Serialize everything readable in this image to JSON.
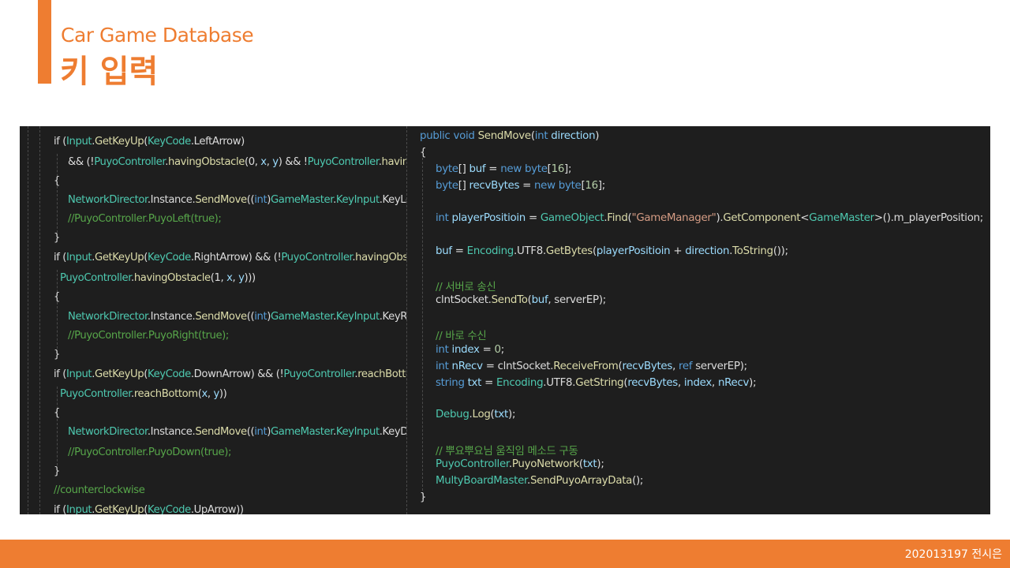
{
  "slide": {
    "title": "Car Game Database",
    "subtitle": "키 입력",
    "footer_text": "202013197 전시은"
  },
  "colors": {
    "accent": "#ee7d31",
    "editor_background": "#1e1e1e",
    "keyword": "#569cd6",
    "type": "#4ec9b0",
    "method": "#dcdcaa",
    "comment": "#57a64a",
    "string": "#d69d85",
    "number": "#b5cea8",
    "variable": "#9cdcfe",
    "plain": "#dcdcdc"
  },
  "left_code_lines": [
    [
      [
        "plain",
        "if ("
      ],
      [
        "type",
        "Input"
      ],
      [
        "plain",
        "."
      ],
      [
        "method",
        "GetKeyUp"
      ],
      [
        "plain",
        "("
      ],
      [
        "type",
        "KeyCode"
      ],
      [
        "plain",
        "."
      ],
      [
        "plain",
        "LeftArrow"
      ],
      [
        "plain",
        ")"
      ]
    ],
    [
      [
        "plain",
        "&& (!"
      ],
      [
        "type",
        "PuyoController"
      ],
      [
        "plain",
        "."
      ],
      [
        "method",
        "havingObstacle"
      ],
      [
        "plain",
        "(0, "
      ],
      [
        "variable",
        "x"
      ],
      [
        "plain",
        ", "
      ],
      [
        "variable",
        "y"
      ],
      [
        "plain",
        ") && !"
      ],
      [
        "type",
        "PuyoController"
      ],
      [
        "plain",
        "."
      ],
      [
        "method",
        "havingObstacle"
      ],
      [
        "plain",
        "(1, x, y)))"
      ]
    ],
    [
      [
        "plain",
        "{"
      ]
    ],
    [
      [
        "type",
        "NetworkDirector"
      ],
      [
        "plain",
        "."
      ],
      [
        "plain",
        "Instance"
      ],
      [
        "plain",
        "."
      ],
      [
        "method",
        "SendMove"
      ],
      [
        "plain",
        "(("
      ],
      [
        "keyword",
        "int"
      ],
      [
        "plain",
        ")"
      ],
      [
        "type",
        "GameMaster"
      ],
      [
        "plain",
        "."
      ],
      [
        "type",
        "KeyInput"
      ],
      [
        "plain",
        "."
      ],
      [
        "plain",
        "KeyLeft);"
      ]
    ],
    [
      [
        "comment",
        "//PuyoController.PuyoLeft(true);"
      ]
    ],
    [
      [
        "plain",
        "}"
      ]
    ],
    [
      [
        "plain",
        "if ("
      ],
      [
        "type",
        "Input"
      ],
      [
        "plain",
        "."
      ],
      [
        "method",
        "GetKeyUp"
      ],
      [
        "plain",
        "("
      ],
      [
        "type",
        "KeyCode"
      ],
      [
        "plain",
        "."
      ],
      [
        "plain",
        "RightArrow"
      ],
      [
        "plain",
        ") && (!"
      ],
      [
        "type",
        "PuyoController"
      ],
      [
        "plain",
        "."
      ],
      [
        "method",
        "havingObstacle"
      ],
      [
        "plain",
        "(0, x, y) &&"
      ]
    ],
    [
      [
        "type",
        "PuyoController"
      ],
      [
        "plain",
        "."
      ],
      [
        "method",
        "havingObstacle"
      ],
      [
        "plain",
        "(1, "
      ],
      [
        "variable",
        "x"
      ],
      [
        "plain",
        ", "
      ],
      [
        "variable",
        "y"
      ],
      [
        "plain",
        ")))"
      ]
    ],
    [
      [
        "plain",
        "{"
      ]
    ],
    [
      [
        "type",
        "NetworkDirector"
      ],
      [
        "plain",
        "."
      ],
      [
        "plain",
        "Instance"
      ],
      [
        "plain",
        "."
      ],
      [
        "method",
        "SendMove"
      ],
      [
        "plain",
        "(("
      ],
      [
        "keyword",
        "int"
      ],
      [
        "plain",
        ")"
      ],
      [
        "type",
        "GameMaster"
      ],
      [
        "plain",
        "."
      ],
      [
        "type",
        "KeyInput"
      ],
      [
        "plain",
        "."
      ],
      [
        "plain",
        "KeyRight);"
      ]
    ],
    [
      [
        "comment",
        "//PuyoController.PuyoRight(true);"
      ]
    ],
    [
      [
        "plain",
        "}"
      ]
    ],
    [
      [
        "plain",
        "if ("
      ],
      [
        "type",
        "Input"
      ],
      [
        "plain",
        "."
      ],
      [
        "method",
        "GetKeyUp"
      ],
      [
        "plain",
        "("
      ],
      [
        "type",
        "KeyCode"
      ],
      [
        "plain",
        "."
      ],
      [
        "plain",
        "DownArrow"
      ],
      [
        "plain",
        ") && (!"
      ],
      [
        "type",
        "PuyoController"
      ],
      [
        "plain",
        "."
      ],
      [
        "method",
        "reachBottom"
      ],
      [
        "plain",
        "(x, y) &&"
      ]
    ],
    [
      [
        "type",
        "PuyoController"
      ],
      [
        "plain",
        "."
      ],
      [
        "method",
        "reachBottom"
      ],
      [
        "plain",
        "("
      ],
      [
        "variable",
        "x"
      ],
      [
        "plain",
        ", "
      ],
      [
        "variable",
        "y"
      ],
      [
        "plain",
        "))"
      ]
    ],
    [
      [
        "plain",
        "{"
      ]
    ],
    [
      [
        "type",
        "NetworkDirector"
      ],
      [
        "plain",
        "."
      ],
      [
        "plain",
        "Instance"
      ],
      [
        "plain",
        "."
      ],
      [
        "method",
        "SendMove"
      ],
      [
        "plain",
        "(("
      ],
      [
        "keyword",
        "int"
      ],
      [
        "plain",
        ")"
      ],
      [
        "type",
        "GameMaster"
      ],
      [
        "plain",
        "."
      ],
      [
        "type",
        "KeyInput"
      ],
      [
        "plain",
        "."
      ],
      [
        "plain",
        "KeyDown);"
      ]
    ],
    [
      [
        "comment",
        "//PuyoController.PuyoDown(true);"
      ]
    ],
    [
      [
        "plain",
        "}"
      ]
    ],
    [
      [
        "comment",
        "//counterclockwise"
      ]
    ],
    [
      [
        "plain",
        "if ("
      ],
      [
        "type",
        "Input"
      ],
      [
        "plain",
        "."
      ],
      [
        "method",
        "GetKeyUp"
      ],
      [
        "plain",
        "("
      ],
      [
        "type",
        "KeyCode"
      ],
      [
        "plain",
        "."
      ],
      [
        "plain",
        "UpArrow"
      ],
      [
        "plain",
        "))"
      ]
    ]
  ],
  "right_code_lines": [
    [
      [
        "keyword",
        "public"
      ],
      [
        "plain",
        " "
      ],
      [
        "keyword",
        "void"
      ],
      [
        "plain",
        " "
      ],
      [
        "method",
        "SendMove"
      ],
      [
        "plain",
        "("
      ],
      [
        "keyword",
        "int"
      ],
      [
        "plain",
        " "
      ],
      [
        "variable",
        "direction"
      ],
      [
        "plain",
        ")"
      ]
    ],
    [
      [
        "plain",
        "{"
      ]
    ],
    [
      [
        "keyword",
        "byte"
      ],
      [
        "plain",
        "[] "
      ],
      [
        "variable",
        "buf"
      ],
      [
        "plain",
        " = "
      ],
      [
        "keyword",
        "new"
      ],
      [
        "plain",
        " "
      ],
      [
        "keyword",
        "byte"
      ],
      [
        "plain",
        "["
      ],
      [
        "number",
        "16"
      ],
      [
        "plain",
        "];"
      ]
    ],
    [
      [
        "keyword",
        "byte"
      ],
      [
        "plain",
        "[] "
      ],
      [
        "variable",
        "recvBytes"
      ],
      [
        "plain",
        " = "
      ],
      [
        "keyword",
        "new"
      ],
      [
        "plain",
        " "
      ],
      [
        "keyword",
        "byte"
      ],
      [
        "plain",
        "["
      ],
      [
        "number",
        "16"
      ],
      [
        "plain",
        "];"
      ]
    ],
    [
      [
        "keyword",
        "int"
      ],
      [
        "plain",
        " "
      ],
      [
        "variable",
        "playerPositioin"
      ],
      [
        "plain",
        " = "
      ],
      [
        "type",
        "GameObject"
      ],
      [
        "plain",
        "."
      ],
      [
        "method",
        "Find"
      ],
      [
        "plain",
        "("
      ],
      [
        "string",
        "\"GameManager\""
      ],
      [
        "plain",
        ")."
      ],
      [
        "method",
        "GetComponent"
      ],
      [
        "plain",
        "<"
      ],
      [
        "type",
        "GameMaster"
      ],
      [
        "plain",
        ">()."
      ],
      [
        "plain",
        "m_playerPosition;"
      ]
    ],
    [
      [
        "variable",
        "buf"
      ],
      [
        "plain",
        " = "
      ],
      [
        "type",
        "Encoding"
      ],
      [
        "plain",
        "."
      ],
      [
        "plain",
        "UTF8"
      ],
      [
        "plain",
        "."
      ],
      [
        "method",
        "GetBytes"
      ],
      [
        "plain",
        "("
      ],
      [
        "variable",
        "playerPositioin"
      ],
      [
        "plain",
        " + "
      ],
      [
        "variable",
        "direction"
      ],
      [
        "plain",
        "."
      ],
      [
        "method",
        "ToString"
      ],
      [
        "plain",
        "());"
      ]
    ],
    [
      [
        "comment",
        "// 서버로 송신"
      ]
    ],
    [
      [
        "plain",
        "clntSocket"
      ],
      [
        "plain",
        "."
      ],
      [
        "method",
        "SendTo"
      ],
      [
        "plain",
        "("
      ],
      [
        "variable",
        "buf"
      ],
      [
        "plain",
        ", serverEP);"
      ]
    ],
    [
      [
        "comment",
        "// 바로 수신"
      ]
    ],
    [
      [
        "keyword",
        "int"
      ],
      [
        "plain",
        " "
      ],
      [
        "variable",
        "index"
      ],
      [
        "plain",
        " = "
      ],
      [
        "number",
        "0"
      ],
      [
        "plain",
        ";"
      ]
    ],
    [
      [
        "keyword",
        "int"
      ],
      [
        "plain",
        " "
      ],
      [
        "variable",
        "nRecv"
      ],
      [
        "plain",
        " = clntSocket."
      ],
      [
        "method",
        "ReceiveFrom"
      ],
      [
        "plain",
        "("
      ],
      [
        "variable",
        "recvBytes"
      ],
      [
        "plain",
        ", "
      ],
      [
        "keyword",
        "ref"
      ],
      [
        "plain",
        " serverEP);"
      ]
    ],
    [
      [
        "keyword",
        "string"
      ],
      [
        "plain",
        " "
      ],
      [
        "variable",
        "txt"
      ],
      [
        "plain",
        " = "
      ],
      [
        "type",
        "Encoding"
      ],
      [
        "plain",
        "."
      ],
      [
        "plain",
        "UTF8"
      ],
      [
        "plain",
        "."
      ],
      [
        "method",
        "GetString"
      ],
      [
        "plain",
        "("
      ],
      [
        "variable",
        "recvBytes"
      ],
      [
        "plain",
        ", "
      ],
      [
        "variable",
        "index"
      ],
      [
        "plain",
        ", "
      ],
      [
        "variable",
        "nRecv"
      ],
      [
        "plain",
        ");"
      ]
    ],
    [
      [
        "type",
        "Debug"
      ],
      [
        "plain",
        "."
      ],
      [
        "method",
        "Log"
      ],
      [
        "plain",
        "("
      ],
      [
        "variable",
        "txt"
      ],
      [
        "plain",
        ");"
      ]
    ],
    [
      [
        "comment",
        "// 뿌요뿌요님 움직임 메소드 구동"
      ]
    ],
    [
      [
        "type",
        "PuyoController"
      ],
      [
        "plain",
        "."
      ],
      [
        "method",
        "PuyoNetwork"
      ],
      [
        "plain",
        "("
      ],
      [
        "variable",
        "txt"
      ],
      [
        "plain",
        ");"
      ]
    ],
    [
      [
        "type",
        "MultyBoardMaster"
      ],
      [
        "plain",
        "."
      ],
      [
        "method",
        "SendPuyoArrayData"
      ],
      [
        "plain",
        "();"
      ]
    ],
    [
      [
        "plain",
        "}"
      ]
    ]
  ]
}
